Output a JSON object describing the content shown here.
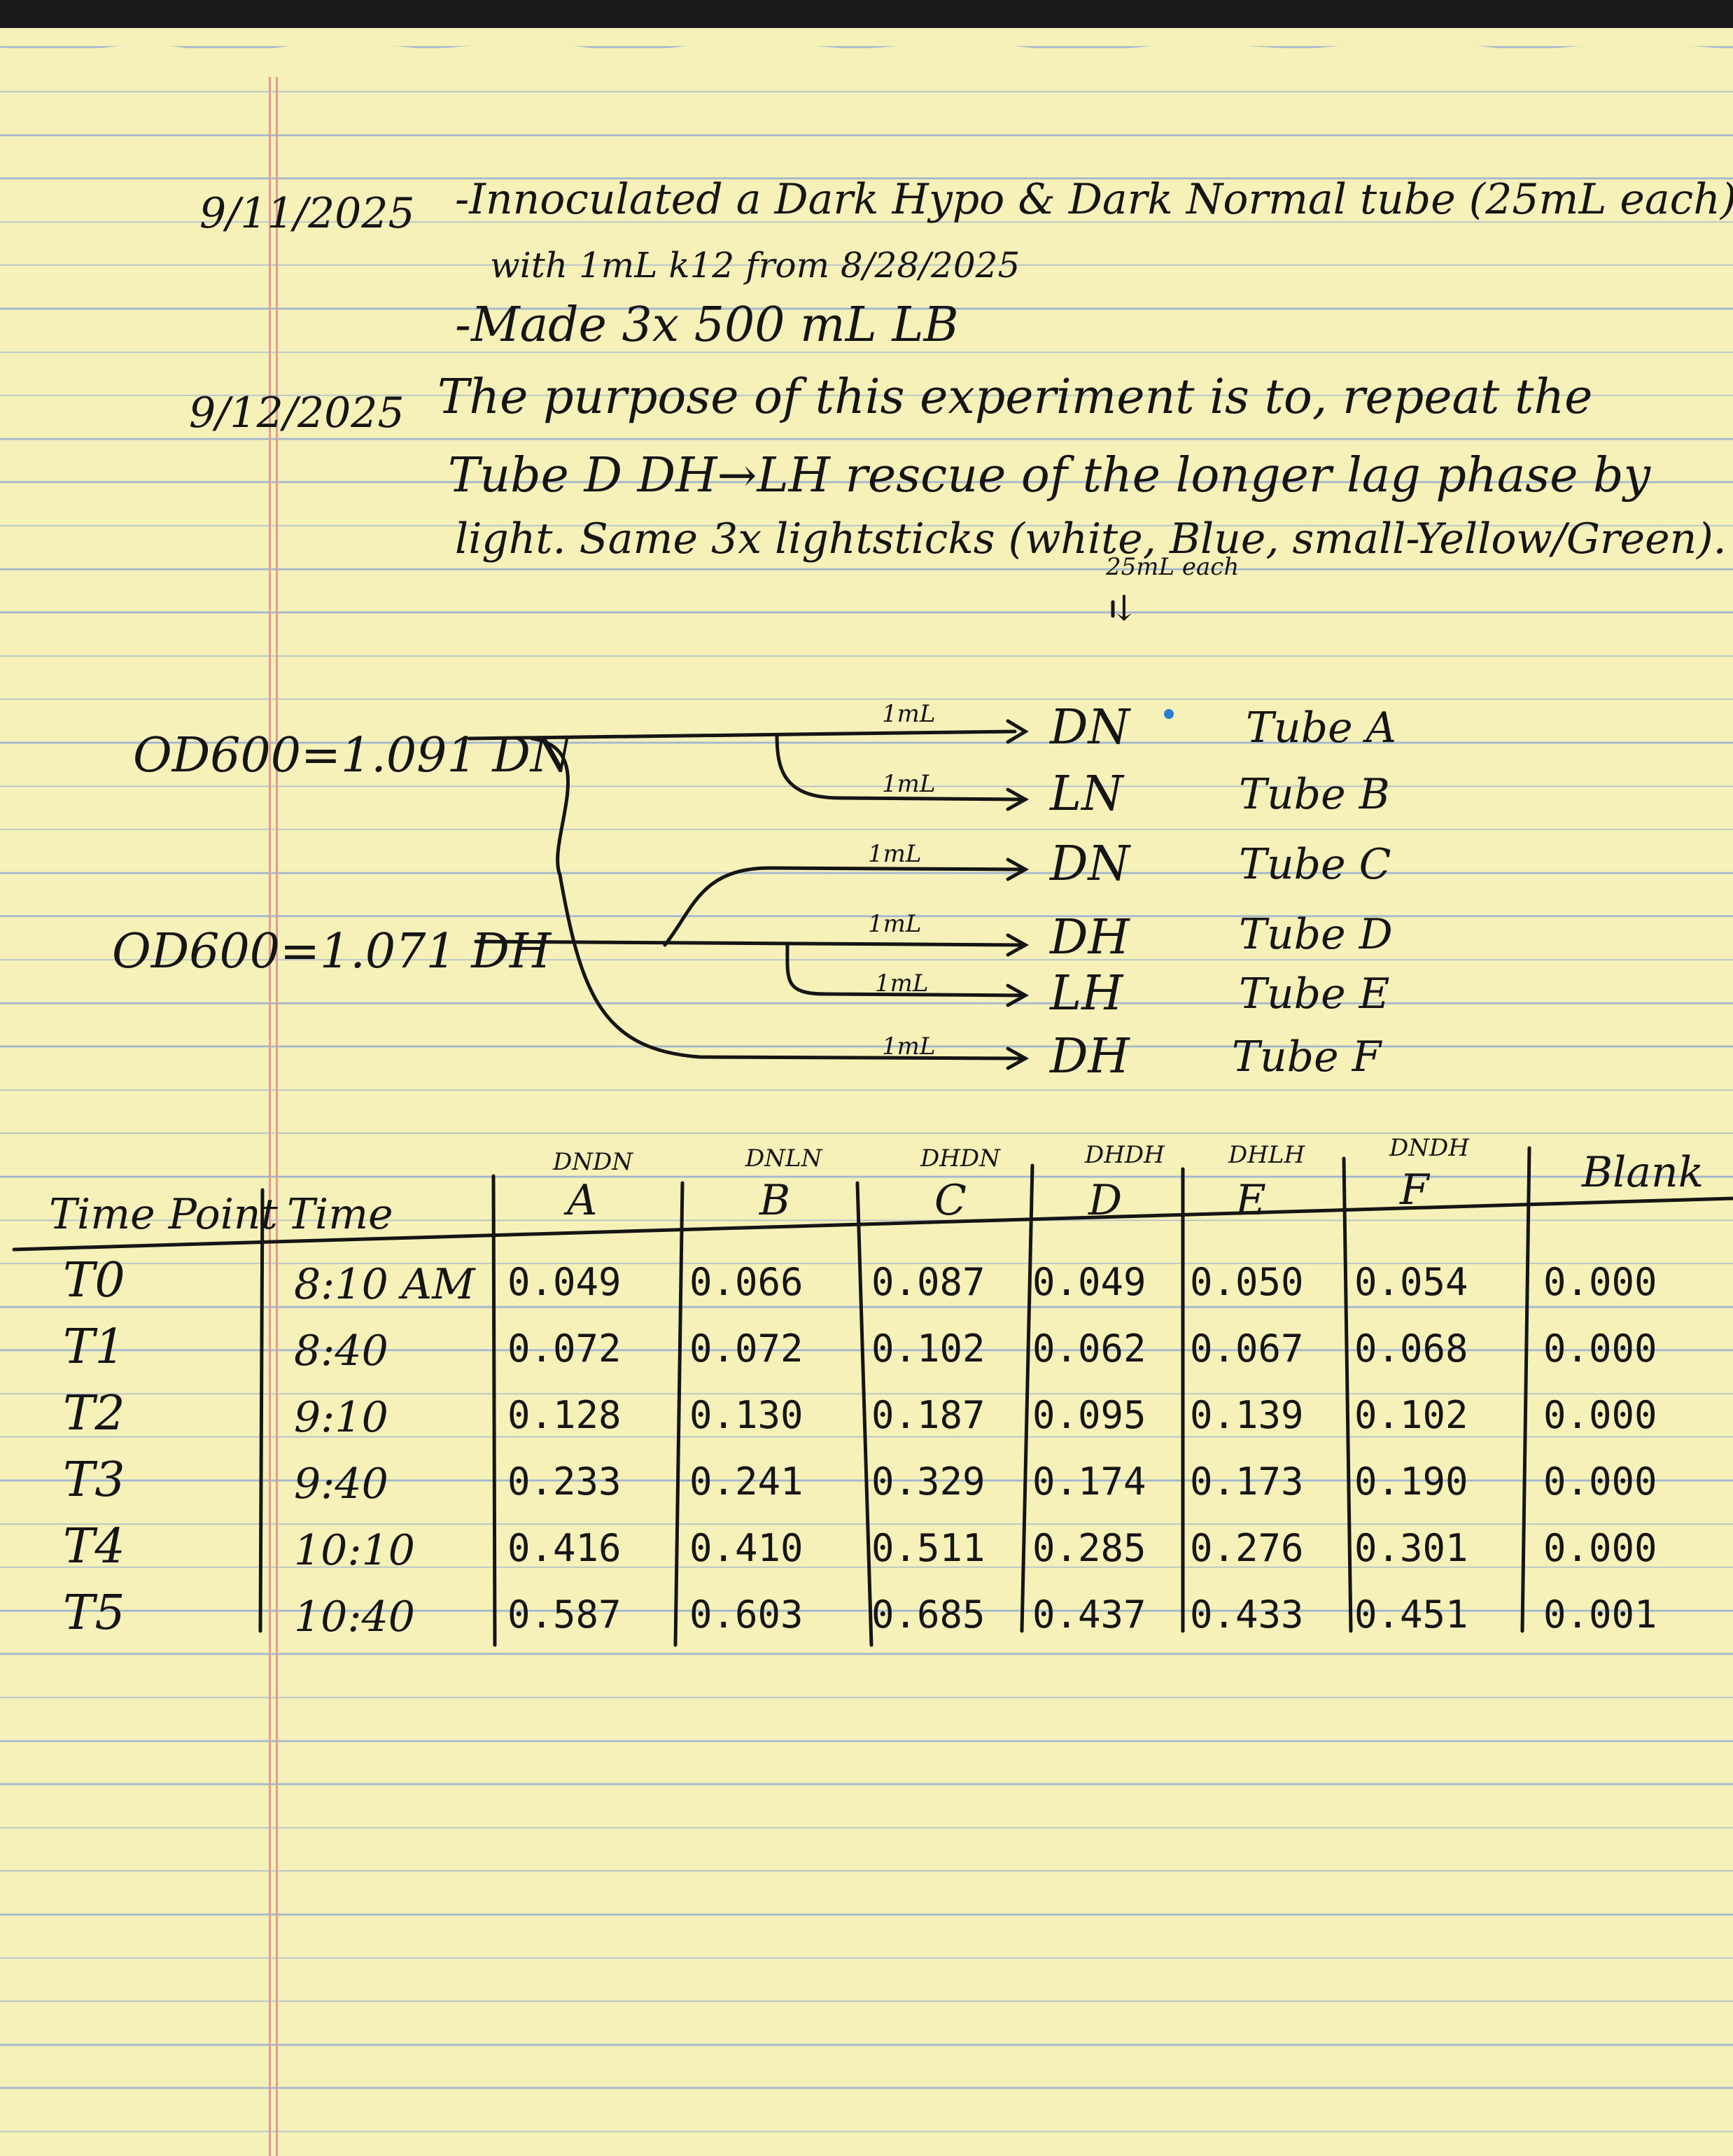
{
  "notes": {
    "date1": "9/11/2025",
    "line1": "-Innoculated a Dark Hypo & Dark Normal tube (25mL each)",
    "line1b": "with 1mL k12 from 8/28/2025",
    "line2": "-Made 3x 500 mL LB",
    "date2": "9/12/2025",
    "purpose1": "The purpose of this experiment is to, repeat the",
    "purpose2": "Tube D DH→LH rescue of the longer lag phase by",
    "purpose3": "light. Same 3x lightsticks (white, Blue, small-Yellow/Green).",
    "annot": "25mL each",
    "arrow": "↓"
  },
  "diagram": {
    "source_dn": "OD600=1.091 DN",
    "source_dh": "OD600=1.071 DH",
    "transfer": "1mL",
    "tubes": [
      {
        "sample": "DN",
        "tube": "Tube A"
      },
      {
        "sample": "LN",
        "tube": "Tube B"
      },
      {
        "sample": "DN",
        "tube": "Tube C"
      },
      {
        "sample": "DH",
        "tube": "Tube D"
      },
      {
        "sample": "LH",
        "tube": "Tube E"
      },
      {
        "sample": "DH",
        "tube": "Tube F"
      }
    ]
  },
  "table": {
    "col_timepoint": "Time Point",
    "col_time": "Time",
    "columns": [
      {
        "sub": "DNDN",
        "letter": "A"
      },
      {
        "sub": "DNLN",
        "letter": "B"
      },
      {
        "sub": "DHDN",
        "letter": "C"
      },
      {
        "sub": "DHDH",
        "letter": "D"
      },
      {
        "sub": "DHLH",
        "letter": "E"
      },
      {
        "sub": "DNDH",
        "letter": "F"
      }
    ],
    "col_blank": "Blank",
    "rows": [
      {
        "tp": "T0",
        "time": "8:10 AM",
        "v": [
          "0.049",
          "0.066",
          "0.087",
          "0.049",
          "0.050",
          "0.054",
          "0.000"
        ]
      },
      {
        "tp": "T1",
        "time": "8:40",
        "v": [
          "0.072",
          "0.072",
          "0.102",
          "0.062",
          "0.067",
          "0.068",
          "0.000"
        ]
      },
      {
        "tp": "T2",
        "time": "9:10",
        "v": [
          "0.128",
          "0.130",
          "0.187",
          "0.095",
          "0.139",
          "0.102",
          "0.000"
        ]
      },
      {
        "tp": "T3",
        "time": "9:40",
        "v": [
          "0.233",
          "0.241",
          "0.329",
          "0.174",
          "0.173",
          "0.190",
          "0.000"
        ]
      },
      {
        "tp": "T4",
        "time": "10:10",
        "v": [
          "0.416",
          "0.410",
          "0.511",
          "0.285",
          "0.276",
          "0.301",
          "0.000"
        ]
      },
      {
        "tp": "T5",
        "time": "10:40",
        "v": [
          "0.587",
          "0.603",
          "0.685",
          "0.437",
          "0.433",
          "0.451",
          "0.001"
        ]
      }
    ]
  },
  "colors": {
    "paper": "#f6f1b8",
    "rule": "#9fb4cf",
    "margin": "#e59a96",
    "ink": "#151515"
  }
}
